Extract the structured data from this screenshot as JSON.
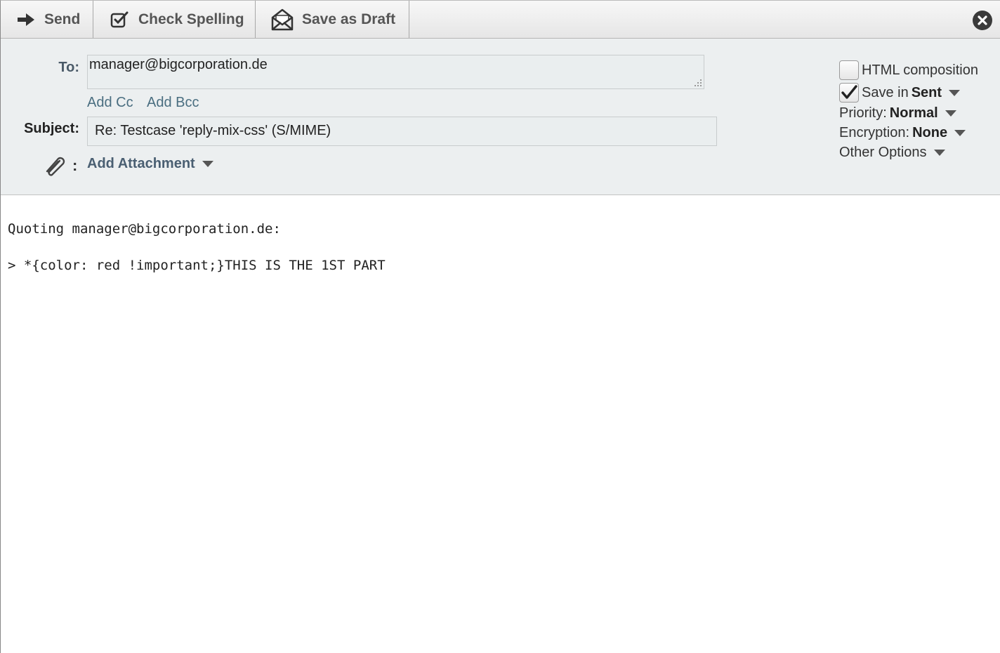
{
  "toolbar": {
    "send_label": "Send",
    "spell_label": "Check Spelling",
    "draft_label": "Save as Draft"
  },
  "header": {
    "to_label": "To:",
    "to_value": "manager@bigcorporation.de",
    "add_cc": "Add Cc",
    "add_bcc": "Add Bcc",
    "subject_label": "Subject:",
    "subject_value": "Re: Testcase 'reply-mix-css' (S/MIME)",
    "attach_colon": ":",
    "add_attachment": "Add Attachment"
  },
  "options": {
    "html_composition": "HTML composition",
    "html_checked": false,
    "save_in_prefix": "Save in",
    "save_in_value": "Sent",
    "save_checked": true,
    "priority_label": "Priority:",
    "priority_value": "Normal",
    "encryption_label": "Encryption:",
    "encryption_value": "None",
    "other_options": "Other Options"
  },
  "body": {
    "line1": "Quoting manager@bigcorporation.de:",
    "line2": "",
    "line3": "> *{color: red !important;}THIS IS THE 1ST PART"
  },
  "icons": {
    "send": "arrow-right-icon",
    "spell": "check-square-icon",
    "draft": "envelope-open-icon",
    "close": "close-circle-icon",
    "attach": "paperclip-icon"
  }
}
